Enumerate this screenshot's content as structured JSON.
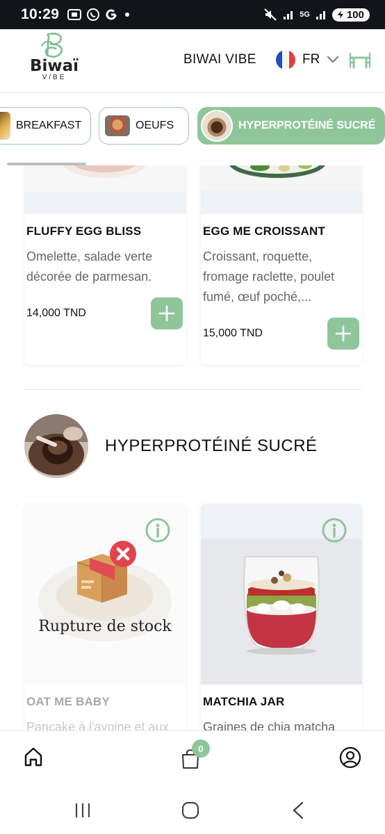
{
  "status_bar": {
    "time": "10:29",
    "app_icons": [
      "screenshot-icon",
      "whatsapp-icon",
      "google-icon",
      "dot-icon"
    ],
    "network_label": "5G",
    "battery": "100"
  },
  "header": {
    "logo_name": "Biwaï",
    "logo_sub": "V/BE",
    "title": "BIWAI VIBE",
    "language": "FR",
    "colors": {
      "accent": "#8ec69a",
      "accent_border": "#9cc8a6"
    }
  },
  "tabs": [
    {
      "label": "BREAKFAST",
      "icon": "breakfast-thumb",
      "active": false
    },
    {
      "label": "OEUFS",
      "icon": "eggs-thumb",
      "active": false
    },
    {
      "label": "HYPERPROTÉINÉ SUCRÉ",
      "icon": "sweet-protein-thumb",
      "active": true
    }
  ],
  "products_top": [
    {
      "name": "FLUFFY EGG BLISS",
      "description": "Omelette, salade verte décorée de parmesan.",
      "price": "14,000 TND"
    },
    {
      "name": "EGG ME CROISSANT",
      "description": "Croissant, roquette, fromage raclette, poulet fumé, œuf poché,...",
      "price": "15,000 TND"
    }
  ],
  "section": {
    "title": "HYPERPROTÉINÉ SUCRÉ"
  },
  "products_section": [
    {
      "name": "OAT ME BABY",
      "description": "Pancake à l'avoine et aux",
      "out_of_stock": true,
      "out_of_stock_label": "Rupture de stock"
    },
    {
      "name": "MATCHIA JAR",
      "description": "Graines de chia matcha",
      "out_of_stock": false
    }
  ],
  "bottom_nav": {
    "cart_count": "0",
    "items": [
      "home-icon",
      "cart-icon",
      "profile-icon"
    ]
  }
}
